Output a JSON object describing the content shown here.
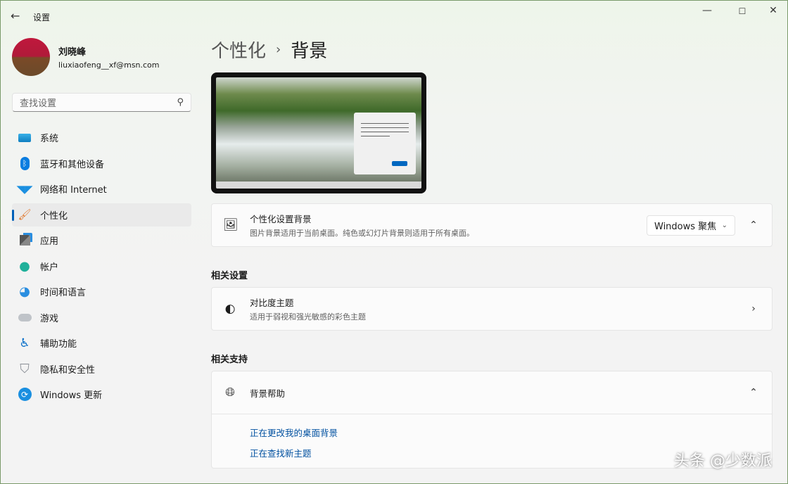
{
  "window": {
    "title": "设置",
    "minimize": "—",
    "maximize": "☐",
    "close": "✕"
  },
  "profile": {
    "name": "刘晓峰",
    "email": "liuxiaofeng__xf@msn.com"
  },
  "search": {
    "placeholder": "查找设置"
  },
  "nav": [
    {
      "label": "系统",
      "icon": "monitor-icon"
    },
    {
      "label": "蓝牙和其他设备",
      "icon": "bluetooth-icon"
    },
    {
      "label": "网络和 Internet",
      "icon": "wifi-icon"
    },
    {
      "label": "个性化",
      "icon": "brush-icon",
      "active": true
    },
    {
      "label": "应用",
      "icon": "apps-icon"
    },
    {
      "label": "帐户",
      "icon": "person-icon"
    },
    {
      "label": "时间和语言",
      "icon": "clock-globe-icon"
    },
    {
      "label": "游戏",
      "icon": "gamepad-icon"
    },
    {
      "label": "辅助功能",
      "icon": "accessibility-icon"
    },
    {
      "label": "隐私和安全性",
      "icon": "shield-icon"
    },
    {
      "label": "Windows 更新",
      "icon": "update-icon"
    }
  ],
  "breadcrumb": {
    "parent": "个性化",
    "sep": "›",
    "current": "背景"
  },
  "background": {
    "title": "个性化设置背景",
    "subtitle": "图片背景适用于当前桌面。纯色或幻灯片背景则适用于所有桌面。",
    "value": "Windows 聚焦"
  },
  "related_settings": {
    "heading": "相关设置",
    "contrast_title": "对比度主题",
    "contrast_subtitle": "适用于弱视和强光敏感的彩色主题"
  },
  "related_support": {
    "heading": "相关支持",
    "help_title": "背景帮助",
    "links": [
      "正在更改我的桌面背景",
      "正在查找新主题"
    ]
  },
  "watermark": "头条 @少数派",
  "colors": {
    "accent": "#005fb8",
    "link": "#0050a0"
  }
}
